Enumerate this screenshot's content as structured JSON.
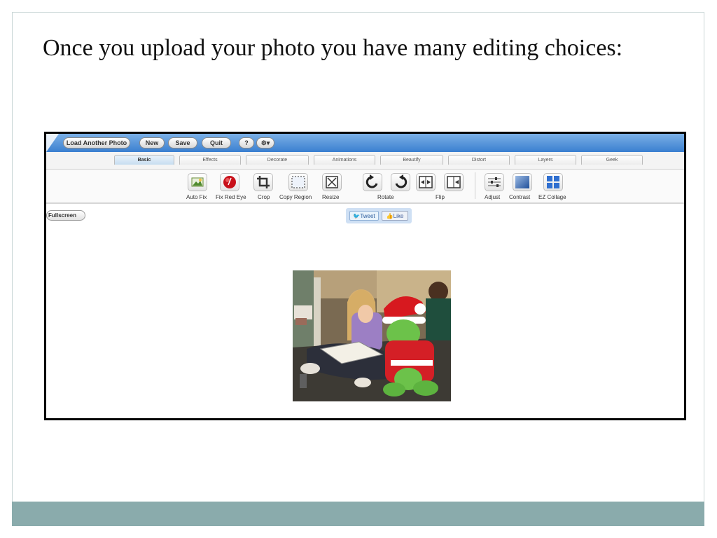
{
  "slide": {
    "title": "Once you upload your photo you have many editing choices:"
  },
  "app": {
    "topbar": {
      "buttons": [
        "Load Another Photo",
        "New",
        "Save",
        "Quit"
      ],
      "help": "?",
      "settings_caret": "▾"
    },
    "tabs": [
      "Basic",
      "Effects",
      "Decorate",
      "Animations",
      "Beautify",
      "Distort",
      "Layers",
      "Geek"
    ],
    "active_tab": "Basic",
    "tools": {
      "auto_fix": "Auto Fix",
      "fix_red_eye": "Fix Red Eye",
      "crop": "Crop",
      "copy_region": "Copy Region",
      "resize": "Resize",
      "rotate": "Rotate",
      "flip": "Flip",
      "adjust": "Adjust",
      "contrast": "Contrast",
      "ez_collage": "EZ Collage"
    },
    "fullscreen": "Fullscreen",
    "social": {
      "tweet": "Tweet",
      "like": "Like"
    }
  },
  "colors": {
    "footer_bar": "#8aabac",
    "topbar": "#3a7fd0",
    "frame_border": "#000000"
  }
}
